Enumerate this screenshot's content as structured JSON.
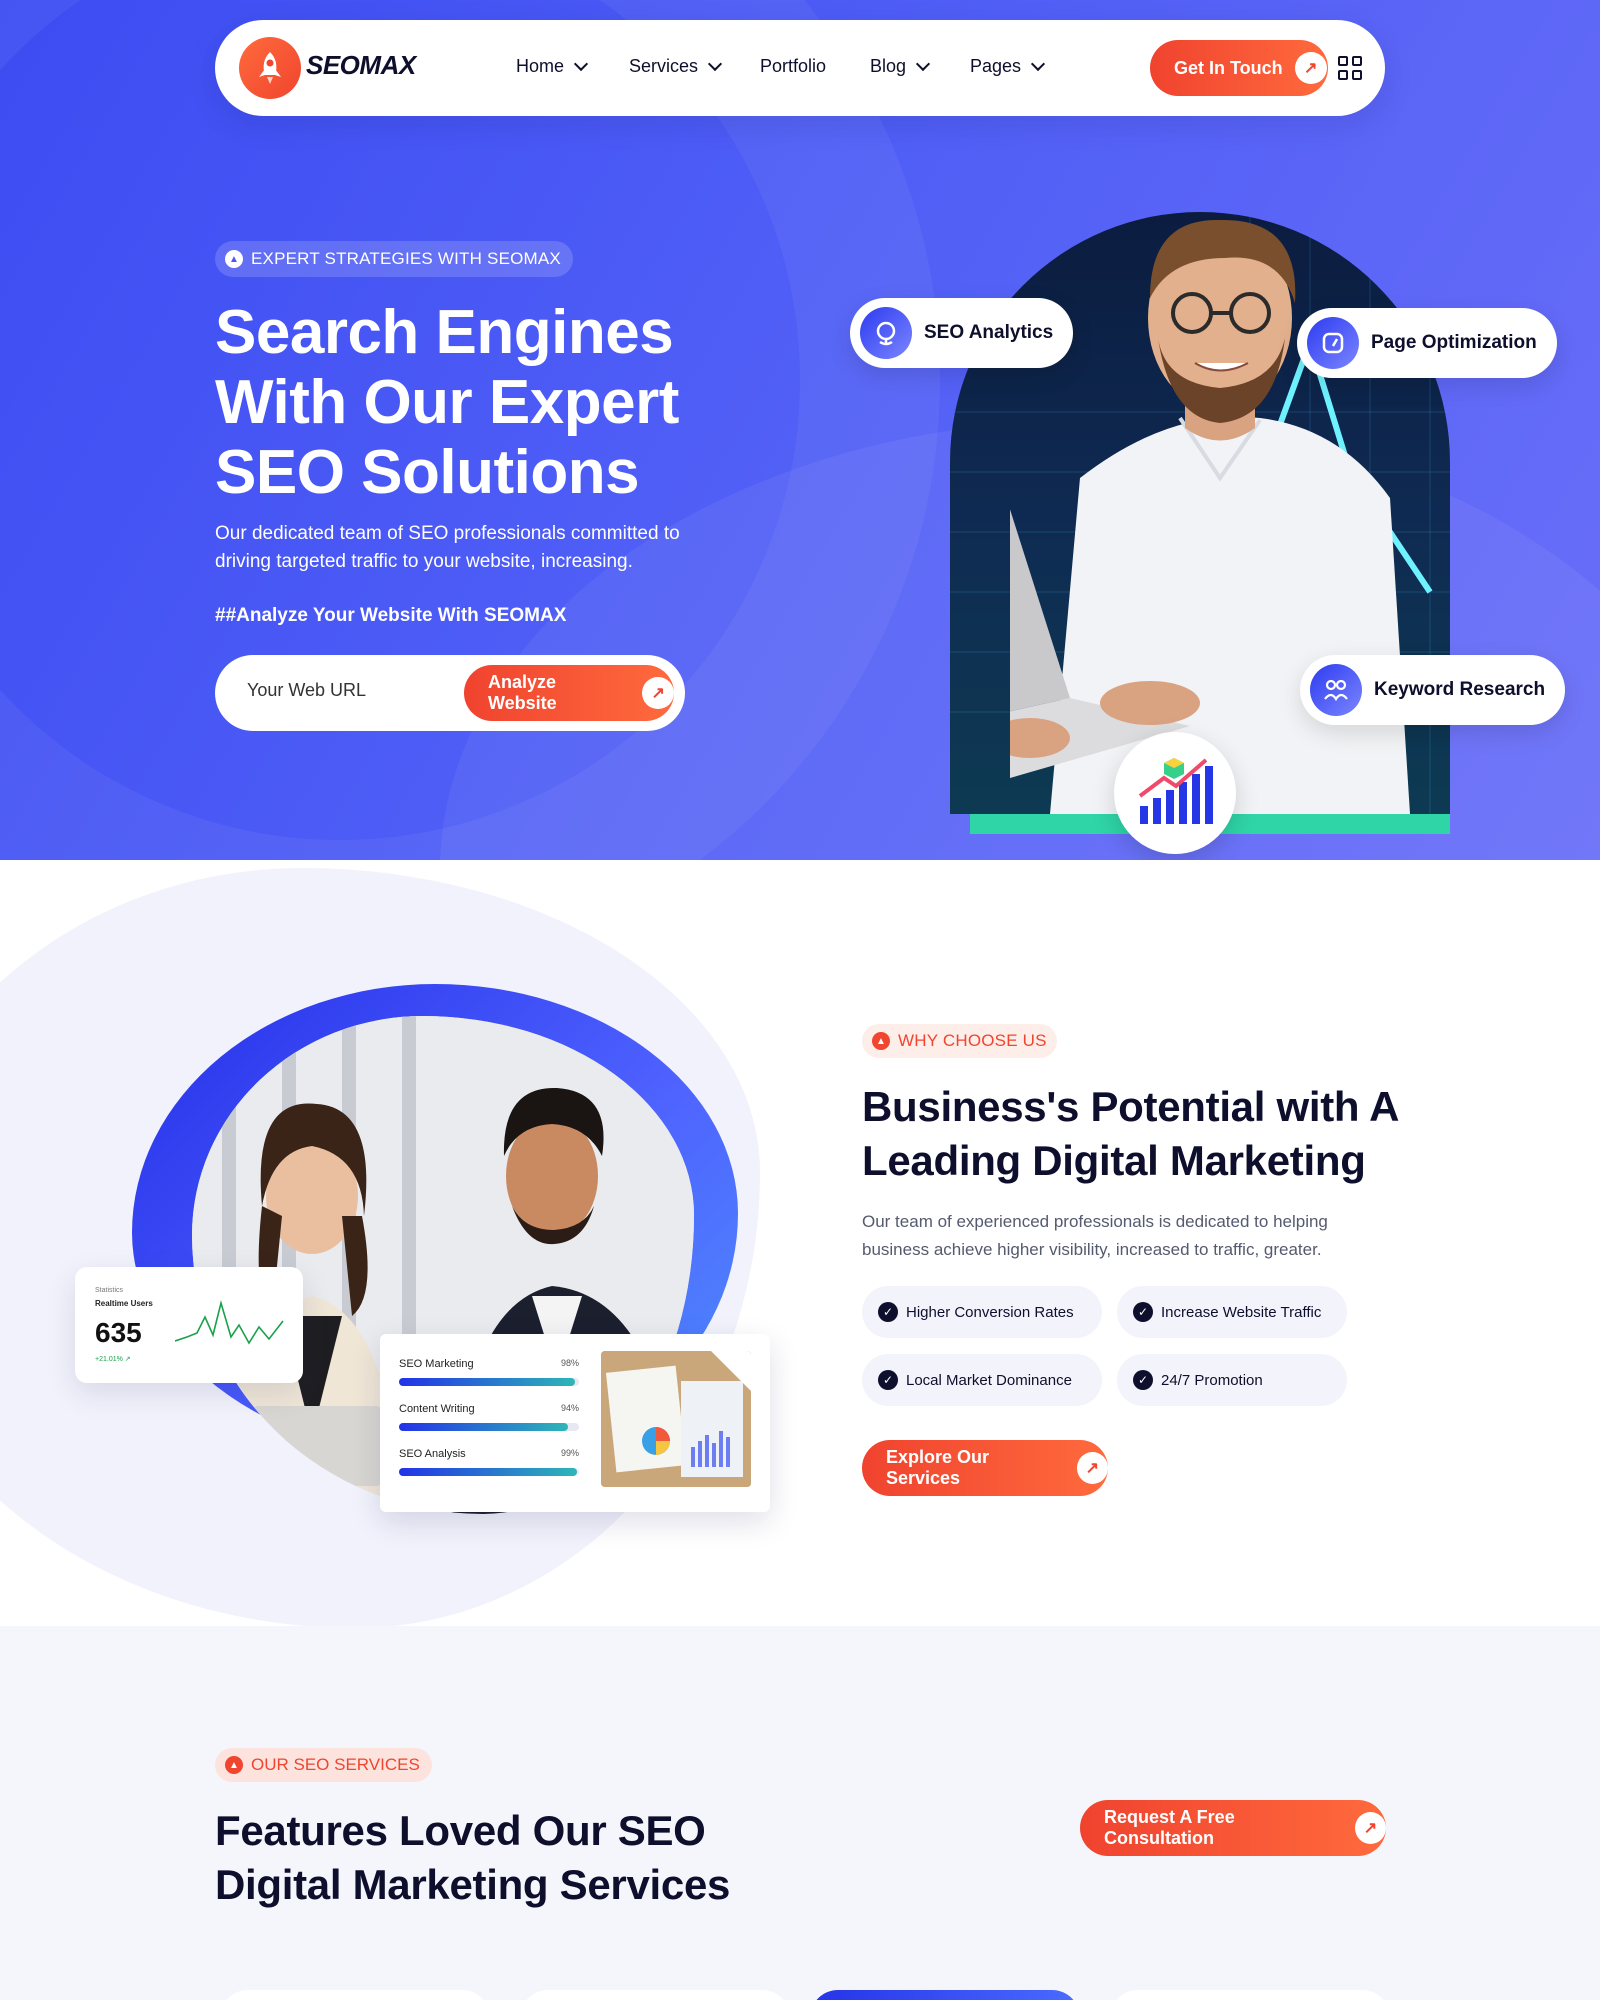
{
  "nav": {
    "logo": "SEOMAX",
    "items": [
      {
        "label": "Home",
        "dropdown": true
      },
      {
        "label": "Services",
        "dropdown": true
      },
      {
        "label": "Portfolio",
        "dropdown": false
      },
      {
        "label": "Blog",
        "dropdown": true
      },
      {
        "label": "Pages",
        "dropdown": true
      }
    ],
    "cta": "Get In Touch"
  },
  "hero": {
    "badge": "EXPERT STRATEGIES WITH SEOMAX",
    "title": "Search Engines With Our Expert SEO Solutions",
    "description": "Our dedicated team of SEO professionals committed to driving targeted traffic to your website, increasing.",
    "tagline": "##Analyze Your Website With SEOMAX",
    "url_placeholder": "Your Web URL",
    "analyze_button": "Analyze Website",
    "pills": {
      "analytics": "SEO Analytics",
      "optimization": "Page Optimization",
      "keyword": "Keyword Research"
    }
  },
  "why": {
    "badge": "WHY CHOOSE US",
    "title": "Business's Potential with A Leading Digital Marketing",
    "description": "Our team of experienced professionals is dedicated to helping business achieve higher visibility, increased to traffic, greater.",
    "features": [
      "Higher Conversion Rates",
      "Increase Website Traffic",
      "Local Market Dominance",
      "24/7 Promotion"
    ],
    "button": "Explore Our Services",
    "stats": {
      "label": "Statistics",
      "title": "Realtime Users",
      "value": "635",
      "change": "+21.01%"
    },
    "skills": [
      {
        "name": "SEO Marketing",
        "pct_label": "98%",
        "pct": 0.98
      },
      {
        "name": "Content Writing",
        "pct_label": "94%",
        "pct": 0.94
      },
      {
        "name": "SEO Analysis",
        "pct_label": "99%",
        "pct": 0.99
      }
    ]
  },
  "services": {
    "badge": "OUR SEO SERVICES",
    "title": "Features Loved Our SEO Digital Marketing Services",
    "button": "Request A Free Consultation"
  },
  "colors": {
    "brand_blue": "#4a57f4",
    "accent_red": "#f0452e",
    "dark": "#0d0f2c"
  }
}
